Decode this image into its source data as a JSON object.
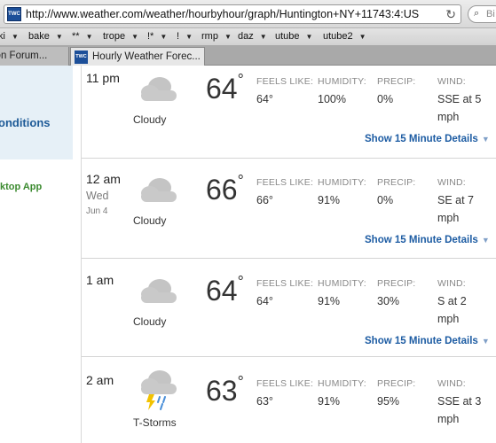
{
  "browser": {
    "url": "http://www.weather.com/weather/hourbyhour/graph/Huntington+NY+11743:4:US",
    "favicon_text": "TWC",
    "search_text": "Bi",
    "reload_icon": "reload-icon"
  },
  "bookmarks": [
    {
      "label": "ki"
    },
    {
      "label": "bake"
    },
    {
      "label": "**"
    },
    {
      "label": "trope"
    },
    {
      "label": "!*"
    },
    {
      "label": "!"
    },
    {
      "label": "rmp"
    },
    {
      "label": "daz"
    },
    {
      "label": "utube"
    },
    {
      "label": "utube2"
    }
  ],
  "tabs": [
    {
      "label": "ion Forum..."
    },
    {
      "label": "Hourly Weather Forec..."
    }
  ],
  "sidebar": {
    "conditions": "onditions",
    "desktop_app": "ktop App"
  },
  "labels": {
    "feels_like": "FEELS LIKE:",
    "humidity": "HUMIDITY:",
    "precip": "PRECIP:",
    "wind": "WIND:",
    "details": "Show 15 Minute Details"
  },
  "hours": [
    {
      "time": "11 pm",
      "day": "",
      "date": "",
      "condition": "Cloudy",
      "temp": "64",
      "deg": "°",
      "feels": "64°",
      "humidity": "100%",
      "precip": "0%",
      "wind1": "SSE at 5",
      "wind2": "mph",
      "icon": "cloud-icon"
    },
    {
      "time": "12 am",
      "day": "Wed",
      "date": "Jun 4",
      "condition": "Cloudy",
      "temp": "66",
      "deg": "°",
      "feels": "66°",
      "humidity": "91%",
      "precip": "0%",
      "wind1": "SE at 7",
      "wind2": "mph",
      "icon": "cloud-icon"
    },
    {
      "time": "1 am",
      "day": "",
      "date": "",
      "condition": "Cloudy",
      "temp": "64",
      "deg": "°",
      "feels": "64°",
      "humidity": "91%",
      "precip": "30%",
      "wind1": "S at 2",
      "wind2": "mph",
      "icon": "cloud-icon"
    },
    {
      "time": "2 am",
      "day": "",
      "date": "",
      "condition": "T-Storms",
      "temp": "63",
      "deg": "°",
      "feels": "63°",
      "humidity": "91%",
      "precip": "95%",
      "wind1": "SSE at 3",
      "wind2": "mph",
      "icon": "thunderstorm-icon"
    }
  ],
  "colors": {
    "link": "#1d5ca3",
    "sidebar_link": "#1d5a97",
    "app_link": "#3b8a2f",
    "cloud": "#c9c9c9"
  }
}
